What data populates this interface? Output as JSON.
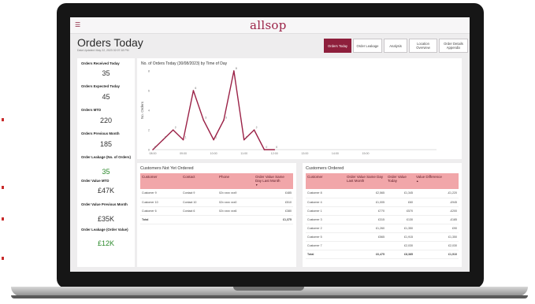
{
  "app": {
    "logo": "allsop",
    "menu_icon": "hamburger-icon",
    "brand_color": "#8e1f3c",
    "accent_pink": "#f1a6a9",
    "positive_color": "#2c8a2c",
    "negative_color": "#d43232"
  },
  "header": {
    "title": "Orders Today",
    "updated": "Data Updated: May 22, 2023 02:07:18 PM"
  },
  "nav": {
    "buttons": [
      {
        "label": "Orders Today",
        "active": true
      },
      {
        "label": "Order Leakage",
        "active": false
      },
      {
        "label": "Analysis",
        "active": false
      },
      {
        "label": "Location Overview",
        "active": false
      },
      {
        "label": "Order Details Appendix",
        "active": false
      }
    ]
  },
  "kpis": [
    {
      "label": "Orders Received Today",
      "value": "35",
      "green": false
    },
    {
      "label": "Orders Expected Today",
      "value": "45",
      "green": false
    },
    {
      "label": "Orders MTD",
      "value": "220",
      "green": false
    },
    {
      "label": "Orders Previous Month",
      "value": "185",
      "green": false
    },
    {
      "label": "Order Leakage (No. of Orders)",
      "value": "35",
      "green": true
    },
    {
      "label": "Order Value MTD",
      "value": "£47K",
      "green": false
    },
    {
      "label": "Order Value Previous Month",
      "value": "£35K",
      "green": false
    },
    {
      "label": "Order Leakage (Order Value)",
      "value": "£12K",
      "green": true
    }
  ],
  "chart_data": {
    "type": "line",
    "title": "No. of Orders Today (30/08/2023) by Time of Day",
    "ylabel": "No. Orders",
    "xlabel": "",
    "ylim": [
      0,
      8
    ],
    "yticks": [
      0,
      2,
      4,
      6,
      8
    ],
    "xlim": [
      0,
      28
    ],
    "xticks": [
      {
        "x": 0,
        "label": "08:00"
      },
      {
        "x": 3,
        "label": "09:00"
      },
      {
        "x": 6,
        "label": "10:00"
      },
      {
        "x": 9,
        "label": "11:00"
      },
      {
        "x": 12,
        "label": "12:00"
      },
      {
        "x": 15,
        "label": "13:00"
      },
      {
        "x": 18,
        "label": "14:00"
      },
      {
        "x": 21,
        "label": "15:00"
      }
    ],
    "grid": false,
    "line_color": "#9b2247",
    "series": [
      {
        "x": [
          8.0,
          8.5,
          9.0,
          9.5,
          10.0,
          10.5,
          11.0,
          11.5,
          12.0,
          12.5,
          13.0,
          13.5,
          14.0
        ],
        "values": [
          0,
          1,
          2,
          1,
          6,
          3,
          1,
          3,
          8,
          1,
          2,
          0,
          0
        ]
      }
    ],
    "data_labels": [
      "0",
      "1",
      "2",
      "1",
      "6",
      "3",
      "1",
      "3",
      "8",
      "1",
      "2",
      "0",
      "0"
    ]
  },
  "not_ordered": {
    "title": "Customers Not Yet Ordered",
    "columns": [
      "Customer",
      "Contact",
      "Phone",
      "Order Value Same Day Last Month"
    ],
    "rows": [
      [
        "Customer 9",
        "Contact 9",
        "02x xxxx xxx9",
        "£485"
      ],
      [
        "Customer 10",
        "Contact 10",
        "02x xxxx xxx0",
        "£510"
      ],
      [
        "Customer 6",
        "Contact 6",
        "02x xxxx xxx6",
        "£380"
      ]
    ],
    "total": [
      "Total",
      "",
      "",
      "£1,375"
    ]
  },
  "ordered": {
    "title": "Customers Ordered",
    "columns": [
      "Customer",
      "Order Value Same Day Last Month",
      "Order Value Today",
      "Value Difference"
    ],
    "rows": [
      [
        "Customer 8",
        "£2,565",
        "£1,345",
        "-£1,220"
      ],
      [
        "Customer 4",
        "£1,005",
        "£60",
        "-£945"
      ],
      [
        "Customer 1",
        "£770",
        "£570",
        "-£200"
      ],
      [
        "Customer 3",
        "£315",
        "£130",
        "-£185"
      ],
      [
        "Customer 2",
        "£1,260",
        "£1,350",
        "£90"
      ],
      [
        "Customer 5",
        "£565",
        "£1,915",
        "£1,350"
      ],
      [
        "Customer 7",
        "",
        "£2,030",
        "£2,030"
      ]
    ],
    "total": [
      "Total",
      "£6,475",
      "£8,385",
      "£1,910"
    ]
  }
}
